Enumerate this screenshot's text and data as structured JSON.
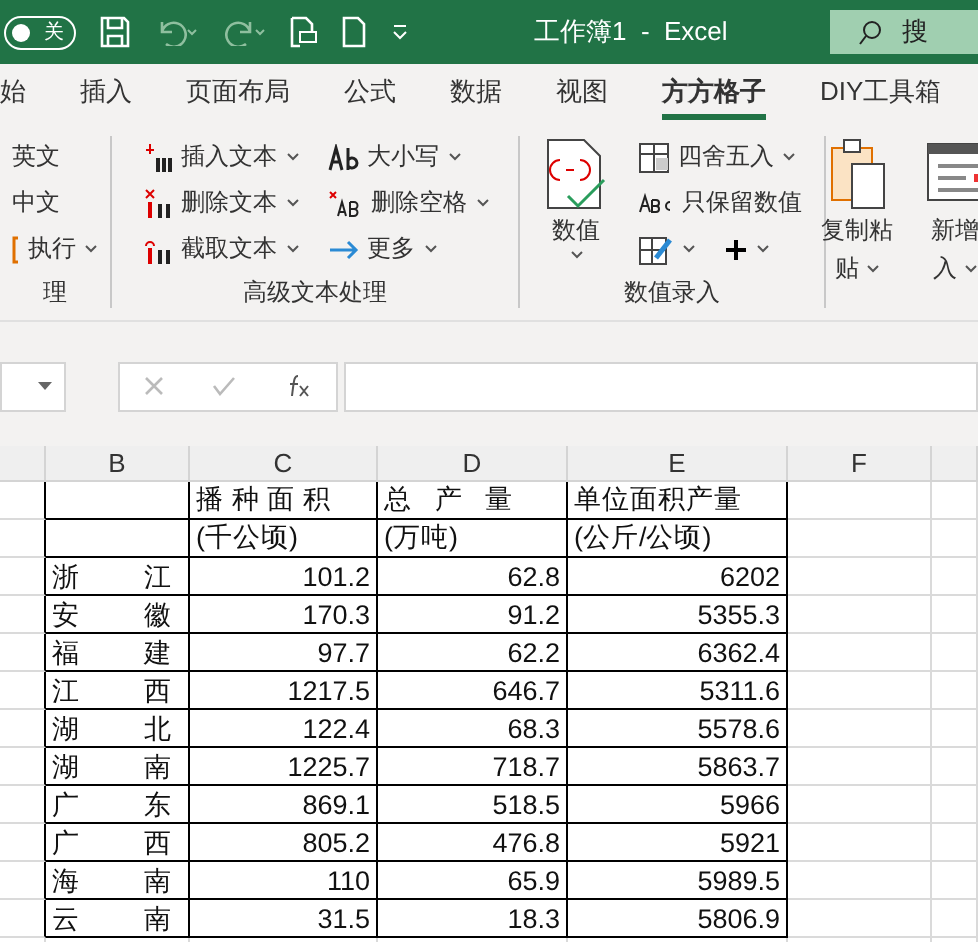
{
  "title_bar": {
    "autosave": {
      "label": "关",
      "on": false
    },
    "title": "工作簿1  -  Excel",
    "search": "搜"
  },
  "tabs": [
    {
      "label": "始",
      "selected": false
    },
    {
      "label": "插入",
      "selected": false
    },
    {
      "label": "页面布局",
      "selected": false
    },
    {
      "label": "公式",
      "selected": false
    },
    {
      "label": "数据",
      "selected": false
    },
    {
      "label": "视图",
      "selected": false
    },
    {
      "label": "方方格子",
      "selected": true
    },
    {
      "label": "DIY工具箱",
      "selected": false
    }
  ],
  "ribbon": [
    {
      "label": "理",
      "columns": [
        [
          {
            "kind": "small",
            "label": "英文",
            "dropdown": false
          },
          {
            "kind": "small",
            "label": "中文",
            "dropdown": false
          },
          {
            "kind": "small",
            "label": "执行",
            "dropdown": true
          }
        ]
      ]
    },
    {
      "label": "高级文本处理",
      "columns": [
        [
          {
            "kind": "small",
            "label": "插入文本",
            "dropdown": true
          },
          {
            "kind": "small",
            "label": "删除文本",
            "dropdown": true
          },
          {
            "kind": "small",
            "label": "截取文本",
            "dropdown": true
          }
        ],
        [
          {
            "kind": "small",
            "label": "大小写",
            "dropdown": true
          },
          {
            "kind": "small",
            "label": "删除空格",
            "dropdown": true
          },
          {
            "kind": "small",
            "label": "更多",
            "dropdown": true
          }
        ]
      ]
    },
    {
      "label": "数值录入",
      "columns": [
        [
          {
            "kind": "large",
            "lines": [
              "数值"
            ],
            "dropdown": true
          }
        ],
        [
          {
            "kind": "small",
            "label": "四舍五入",
            "dropdown": true
          },
          {
            "kind": "small",
            "label": "只保留数值",
            "dropdown": false
          },
          {
            "kind": "icons",
            "dropdown": true
          }
        ]
      ]
    },
    {
      "columns": [
        [
          {
            "kind": "large",
            "lines": [
              "复制粘",
              "贴"
            ],
            "dropdown": true
          }
        ],
        [
          {
            "kind": "large",
            "lines": [
              "新增",
              "入"
            ],
            "dropdown": true
          }
        ]
      ]
    }
  ],
  "sheet": {
    "columns": [
      "B",
      "C",
      "D",
      "E",
      "F"
    ],
    "header_rows": [
      [
        "播 种 面 积",
        "总   产   量",
        "单位面积产量"
      ],
      [
        "(千公顷)",
        "(万吨)",
        "(公斤/公顷)"
      ]
    ],
    "rows": [
      {
        "name": "浙江",
        "values": [
          "101.2",
          "62.8",
          "6202"
        ]
      },
      {
        "name": "安徽",
        "values": [
          "170.3",
          "91.2",
          "5355.3"
        ]
      },
      {
        "name": "福建",
        "values": [
          "97.7",
          "62.2",
          "6362.4"
        ]
      },
      {
        "name": "江西",
        "values": [
          "1217.5",
          "646.7",
          "5311.6"
        ]
      },
      {
        "name": "湖北",
        "values": [
          "122.4",
          "68.3",
          "5578.6"
        ]
      },
      {
        "name": "湖南",
        "values": [
          "1225.7",
          "718.7",
          "5863.7"
        ]
      },
      {
        "name": "广东",
        "values": [
          "869.1",
          "518.5",
          "5966"
        ]
      },
      {
        "name": "广西",
        "values": [
          "805.2",
          "476.8",
          "5921"
        ]
      },
      {
        "name": "海南",
        "values": [
          "110",
          "65.9",
          "5989.5"
        ]
      },
      {
        "name": "云南",
        "values": [
          "31.5",
          "18.3",
          "5806.9"
        ]
      }
    ]
  }
}
